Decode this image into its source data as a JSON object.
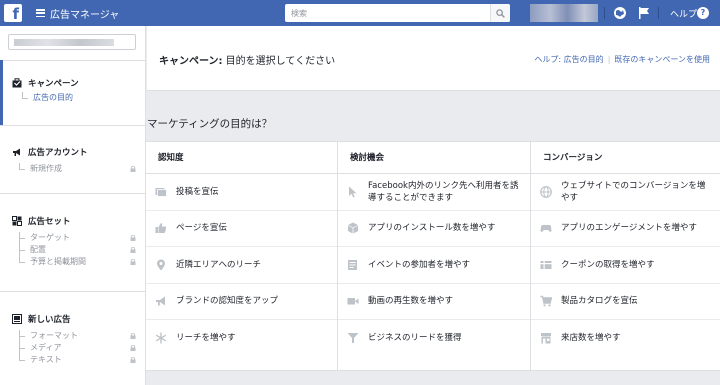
{
  "topbar": {
    "logo": "f",
    "app_title": "広告マネージャ",
    "search_placeholder": "検索",
    "help_label": "ヘルプ",
    "help_icon": "?"
  },
  "sidebar": {
    "sections": [
      {
        "title": "キャンペーン",
        "icon": "briefcase-icon",
        "items": [
          {
            "label": "広告の目的",
            "selected": true
          }
        ]
      },
      {
        "title": "広告アカウント",
        "icon": "megaphone-icon",
        "items": [
          {
            "label": "新規作成"
          }
        ]
      },
      {
        "title": "広告セット",
        "icon": "grid-icon",
        "items": [
          {
            "label": "ターゲット"
          },
          {
            "label": "配置"
          },
          {
            "label": "予算と掲載期間"
          }
        ]
      },
      {
        "title": "新しい広告",
        "icon": "monitor-icon",
        "items": [
          {
            "label": "フォーマット"
          },
          {
            "label": "メディア"
          },
          {
            "label": "テキスト"
          }
        ]
      }
    ]
  },
  "header": {
    "title_bold": "キャンペーン:",
    "title_rest": " 目的を選択してください",
    "link_help": "ヘルプ: 広告の目的",
    "link_existing": "既存のキャンペーンを使用"
  },
  "marketing": {
    "title": "マーケティングの目的は？",
    "columns": [
      {
        "heading": "認知度",
        "objectives": [
          {
            "label": "投稿を宣伝",
            "icon": "post-icon"
          },
          {
            "label": "ページを宣伝",
            "icon": "thumbs-up-icon"
          },
          {
            "label": "近隣エリアへのリーチ",
            "icon": "location-pin-icon"
          },
          {
            "label": "ブランドの認知度をアップ",
            "icon": "megaphone-icon"
          },
          {
            "label": "リーチを増やす",
            "icon": "snowflake-icon"
          }
        ]
      },
      {
        "heading": "検討機会",
        "objectives": [
          {
            "label": "Facebook内外のリンク先へ利用者を誘導することができます",
            "icon": "cursor-icon"
          },
          {
            "label": "アプリのインストール数を増やす",
            "icon": "box-icon"
          },
          {
            "label": "イベントの参加者を増やす",
            "icon": "calendar-icon"
          },
          {
            "label": "動画の再生数を増やす",
            "icon": "video-icon"
          },
          {
            "label": "ビジネスのリードを獲得",
            "icon": "funnel-icon"
          }
        ]
      },
      {
        "heading": "コンバージョン",
        "objectives": [
          {
            "label": "ウェブサイトでのコンバージョンを増やす",
            "icon": "globe-icon"
          },
          {
            "label": "アプリのエンゲージメントを増やす",
            "icon": "gamepad-icon"
          },
          {
            "label": "クーポンの取得を増やす",
            "icon": "offer-icon"
          },
          {
            "label": "製品カタログを宣伝",
            "icon": "cart-icon"
          },
          {
            "label": "来店数を増やす",
            "icon": "store-icon"
          }
        ]
      }
    ]
  },
  "colors": {
    "brand": "#4267b2",
    "icon_gray": "#bec3c9",
    "link": "#4267b2"
  }
}
